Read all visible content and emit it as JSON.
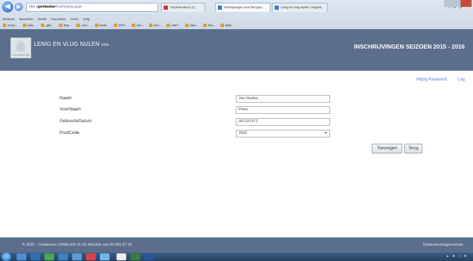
{
  "browser": {
    "address": {
      "prefix": "http://",
      "highlight": "gemlaslwe",
      "suffix": "/inschrijving.aspx"
    },
    "tabs": [
      {
        "label": "Tutorial-videos (1)",
        "active": false
      },
      {
        "label": "Inschrijvingen voor het gea...",
        "active": true
      },
      {
        "label": "Lenig en Vlug Nulen | Registr...",
        "active": false
      }
    ],
    "menu": [
      "Bestand",
      "Bewerken",
      "Beeld",
      "Favorieten",
      "Extra",
      "Help"
    ],
    "favorites": [
      "Knoo...",
      "Valu...",
      "gdb...",
      "http...",
      "Leni...",
      "kank...",
      "EFF...",
      "bor...",
      "nier...",
      "ANP...",
      "Nuit...",
      "Tes...",
      "Web..."
    ]
  },
  "header": {
    "site_title": "LENIG EN VLUG NULEN",
    "site_suffix": "vzw",
    "season_title": "INSCHRIJVINGEN SEIZOEN 2015 - 2016",
    "logo_text": "vzw Lenig en Vlug"
  },
  "links": {
    "change_password": "Wijzig Paswoord",
    "logout": "Log"
  },
  "form": {
    "fields": [
      {
        "label": "Naam",
        "value": "Van Nuelen"
      },
      {
        "label": "VoorNaam",
        "value": "Petra"
      },
      {
        "label": "GeboorteDatum",
        "value": "06/12/1972"
      },
      {
        "label": "PostCode",
        "value": "2560"
      }
    ],
    "submit_label": "Toevoegen",
    "back_label": "Terug"
  },
  "footer": {
    "text": "© 2015 - Contacteer LENIG EN VLUG NULEN vzw 03 481 67 22",
    "right": "Ondersteuningscentrale"
  },
  "colors": {
    "header_bg": "#5b6f8c",
    "link": "#4a83c7"
  }
}
